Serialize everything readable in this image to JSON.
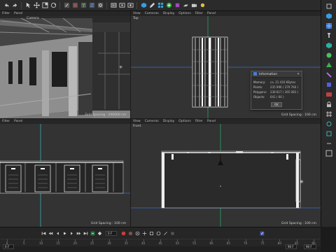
{
  "toolbar": {
    "icons": [
      "undo-icon",
      "redo-icon",
      "select-icon",
      "move-icon",
      "scale-icon",
      "rotate-icon",
      "object-axis-icon",
      "x-axis-icon",
      "y-axis-icon",
      "z-axis-icon",
      "render-view-icon",
      "render-picture-viewer-icon",
      "render-settings-icon",
      "cube-icon",
      "pen-icon",
      "subdivision-icon",
      "cloner-icon",
      "bend-icon",
      "floor-icon",
      "camera-icon",
      "light-icon",
      "sphere-icon"
    ]
  },
  "viewports": {
    "perspective": {
      "menu": [
        "Filter",
        "Panel"
      ],
      "name": "Camera",
      "grid_spacing": "Grid Spacing : 100000 cm"
    },
    "top": {
      "menu": [
        "View",
        "Cameras",
        "Display",
        "Options",
        "Filter",
        "Panel"
      ],
      "name": "Top",
      "grid_spacing": "Grid Spacing : 100 cm"
    },
    "right": {
      "menu": [
        "Filter",
        "Panel"
      ],
      "name": "",
      "grid_spacing": "Grid Spacing : 100 cm"
    },
    "front": {
      "menu": [
        "View",
        "Cameras",
        "Display",
        "Options",
        "Filter",
        "Panel"
      ],
      "name": "Front",
      "grid_spacing": "Grid Spacing : 100 cm"
    }
  },
  "dialog": {
    "title": "Information",
    "rows": [
      {
        "k": "Memory:",
        "v": "ca. 21 416 KBytes"
      },
      {
        "k": "Points:",
        "v": "235 996 ( 379 760 )"
      },
      {
        "k": "Polygons:",
        "v": "238 817 ( 365 083 )"
      },
      {
        "k": "Objects:",
        "v": "641 ( 66 )"
      }
    ],
    "ok_label": "OK"
  },
  "timeline": {
    "current_frame": "0 F",
    "ruler_labels": [
      "0",
      "5",
      "10",
      "15",
      "20",
      "25",
      "30",
      "35",
      "40",
      "45",
      "50",
      "55",
      "60",
      "65",
      "70",
      "75",
      "80",
      "85",
      "90"
    ],
    "start_field": "0 F",
    "end_field": "90 F",
    "end_field2": "90 F"
  },
  "colors": {
    "accent": "#4a7bd0",
    "record": "#d03a3a",
    "green_axis": "#2aa46a",
    "blue_axis": "#2a5ad0",
    "teal_axis": "#3bb0b0"
  }
}
